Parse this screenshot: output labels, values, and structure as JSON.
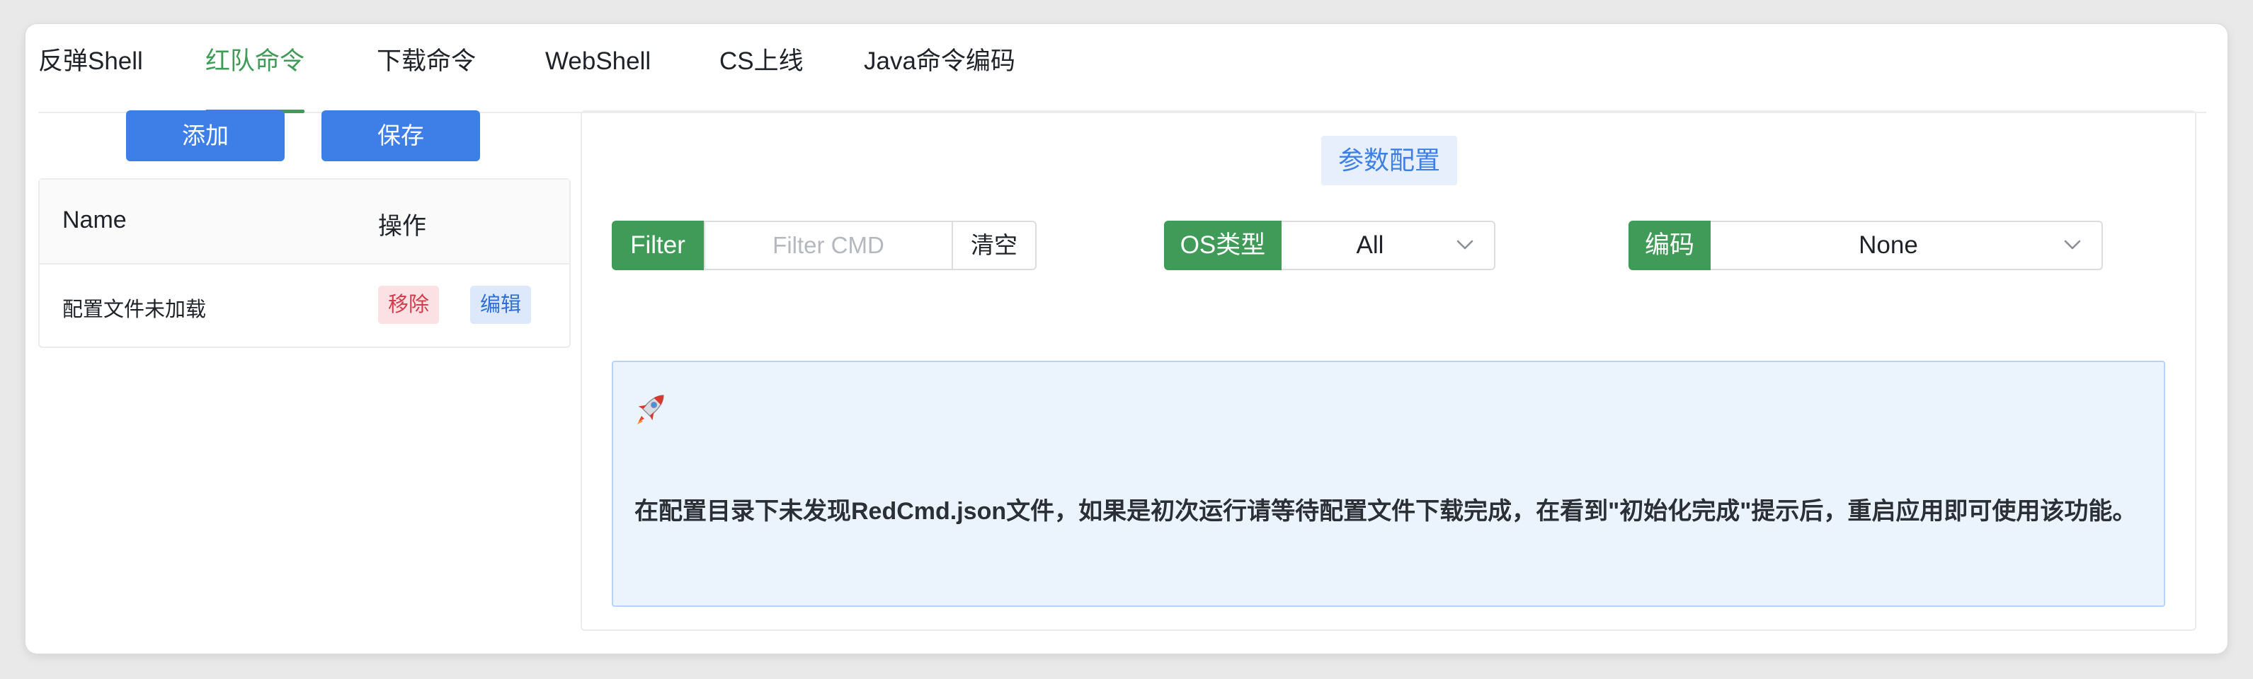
{
  "tabs": [
    {
      "label": "反弹Shell",
      "active": false
    },
    {
      "label": "红队命令",
      "active": true
    },
    {
      "label": "下载命令",
      "active": false
    },
    {
      "label": "WebShell",
      "active": false
    },
    {
      "label": "CS上线",
      "active": false
    },
    {
      "label": "Java命令编码",
      "active": false
    }
  ],
  "actions": {
    "add_label": "添加",
    "save_label": "保存"
  },
  "list": {
    "columns": {
      "name": "Name",
      "operation": "操作"
    },
    "rows": [
      {
        "name": "配置文件未加载",
        "remove_label": "移除",
        "edit_label": "编辑"
      }
    ]
  },
  "config": {
    "title": "参数配置",
    "filter": {
      "label": "Filter",
      "placeholder": "Filter CMD",
      "value": "",
      "clear_label": "清空"
    },
    "os_type": {
      "label": "OS类型",
      "selected": "All"
    },
    "encoding": {
      "label": "编码",
      "selected": "None"
    },
    "notice": {
      "icon": "rocket-icon",
      "message": "在配置目录下未发现RedCmd.json文件，如果是初次运行请等待配置文件下载完成，在看到\"初始化完成\"提示后，重启应用即可使用该功能。"
    }
  },
  "colors": {
    "accent_green": "#3f9b57",
    "primary_blue": "#3d7fe6",
    "danger_red": "#d43b4b",
    "notice_bg": "#ebf3fd"
  }
}
